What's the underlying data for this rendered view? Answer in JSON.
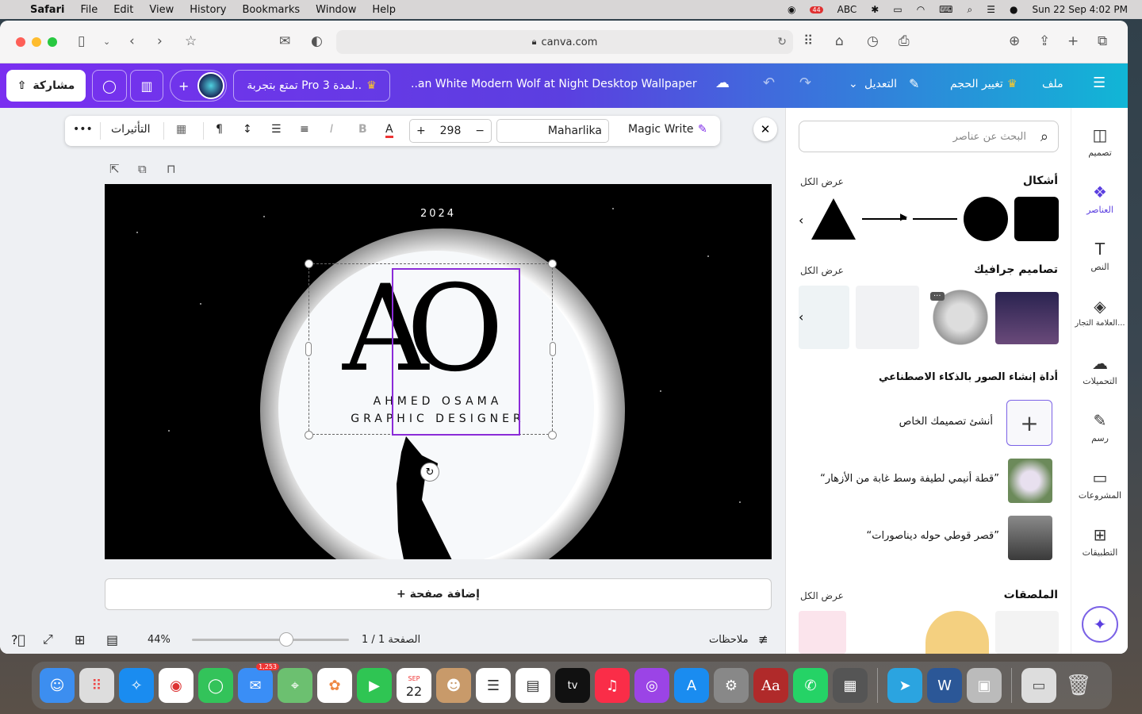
{
  "menubar": {
    "app": "Safari",
    "items": [
      "File",
      "Edit",
      "View",
      "History",
      "Bookmarks",
      "Window",
      "Help"
    ],
    "status": {
      "badge": "44",
      "input": "ABC",
      "datetime": "Sun 22 Sep  4:02 PM"
    }
  },
  "browser": {
    "url": "canva.com"
  },
  "header": {
    "share": "مشاركة",
    "pro_trial": "تمتع بتجربة Pro لمدة 3..",
    "doc_title": "..an White Modern Wolf at Night Desktop Wallpaper",
    "edit": "التعديل",
    "resize": "تغيير الحجم",
    "file": "ملف"
  },
  "text_toolbar": {
    "more": "•••",
    "effects": "التأثيرات",
    "font_size": "298",
    "font_name": "Maharlika",
    "magic_write": "Magic Write",
    "bold": "B",
    "italic": "I"
  },
  "design": {
    "year": "2024",
    "monogram": "AO",
    "name": "AHMED OSAMA",
    "title": "GRAPHIC DESIGNER"
  },
  "add_page": "+ إضافة صفحة",
  "bottom": {
    "zoom": "44%",
    "page": "الصفحة 1 / 1",
    "notes": "ملاحظات",
    "zoom_fraction": 0.6
  },
  "panel": {
    "search_placeholder": "البحث عن عناصر",
    "shapes_title": "أشكال",
    "see_all": "عرض الكل",
    "graphics_title": "تصاميم جرافيك",
    "ai_title": "أداة إنشاء الصور بالذكاء الاصطناعي",
    "create_own": "أنشئ تصميمك الخاص",
    "prompt1": "“قطة أنيمي لطيفة وسط غابة من الأزهار”",
    "prompt2": "“قصر قوطي حوله ديناصورات”",
    "stickers_title": "الملصقات",
    "tile_more": "···"
  },
  "sidenav": [
    {
      "label": "تصميم",
      "icon": "layout-icon"
    },
    {
      "label": "العناصر",
      "icon": "elements-icon"
    },
    {
      "label": "النص",
      "icon": "text-icon"
    },
    {
      "label": "العلامة التجار...",
      "icon": "brand-icon"
    },
    {
      "label": "التحميلات",
      "icon": "upload-icon"
    },
    {
      "label": "رسم",
      "icon": "draw-icon"
    },
    {
      "label": "المشروعات",
      "icon": "folder-icon"
    },
    {
      "label": "التطبيقات",
      "icon": "apps-icon"
    }
  ],
  "dock": {
    "mail_badge": "1,253",
    "cal_month": "SEP",
    "cal_day": "22",
    "tv": "tv",
    "dict": "Aa"
  },
  "colors": {
    "purple": "#7d2ae8",
    "teal": "#11b6d6",
    "selection": "#8b2cd8"
  }
}
